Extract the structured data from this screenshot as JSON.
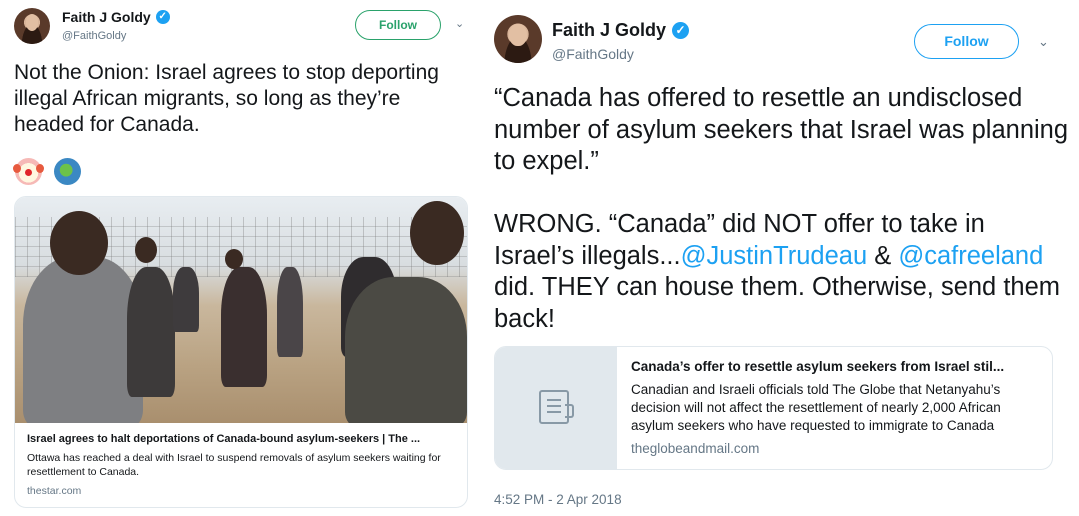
{
  "left_tweet": {
    "author": {
      "name": "Faith J Goldy",
      "handle": "@FaithGoldy",
      "verified_icon": "verified-badge-icon"
    },
    "follow_label": "Follow",
    "text": "Not the Onion: Israel agrees to stop deporting illegal African migrants, so long as they’re headed for Canada.",
    "emojis": [
      "clown-face-emoji",
      "globe-americas-emoji"
    ],
    "card": {
      "title": "Israel agrees to halt deportations of Canada-bound asylum-seekers | The ...",
      "description": "Ottawa has reached a deal with Israel to suspend removals of asylum seekers waiting for resettlement to Canada.",
      "domain": "thestar.com"
    }
  },
  "right_tweet": {
    "author": {
      "name": "Faith J Goldy",
      "handle": "@FaithGoldy",
      "verified_icon": "verified-badge-icon"
    },
    "follow_label": "Follow",
    "text": {
      "quote": "“Canada has offered to resettle an undisclosed number of asylum seekers that Israel was planning to expel.”",
      "part1": "WRONG. “Canada” did NOT offer to take in Israel’s illegals...",
      "mention1": "@JustinTrudeau",
      "amp": " & ",
      "mention2": "@cafreeland",
      "part2": " did. THEY can house them. Otherwise, send them back!"
    },
    "card": {
      "title": "Canada’s offer to resettle asylum seekers from Israel stil...",
      "description": "Canadian and Israeli officials told The Globe that Netanyahu’s decision will not affect the resettlement of nearly 2,000 African asylum seekers who have requested to immigrate to Canada",
      "domain": "theglobeandmail.com"
    },
    "timestamp": "4:52 PM - 2 Apr 2018"
  },
  "colors": {
    "left_follow": "#2aa26b",
    "right_follow": "#1da1f2",
    "mention": "#1da1f2",
    "secondary_text": "#657786",
    "border": "#e1e8ed"
  }
}
